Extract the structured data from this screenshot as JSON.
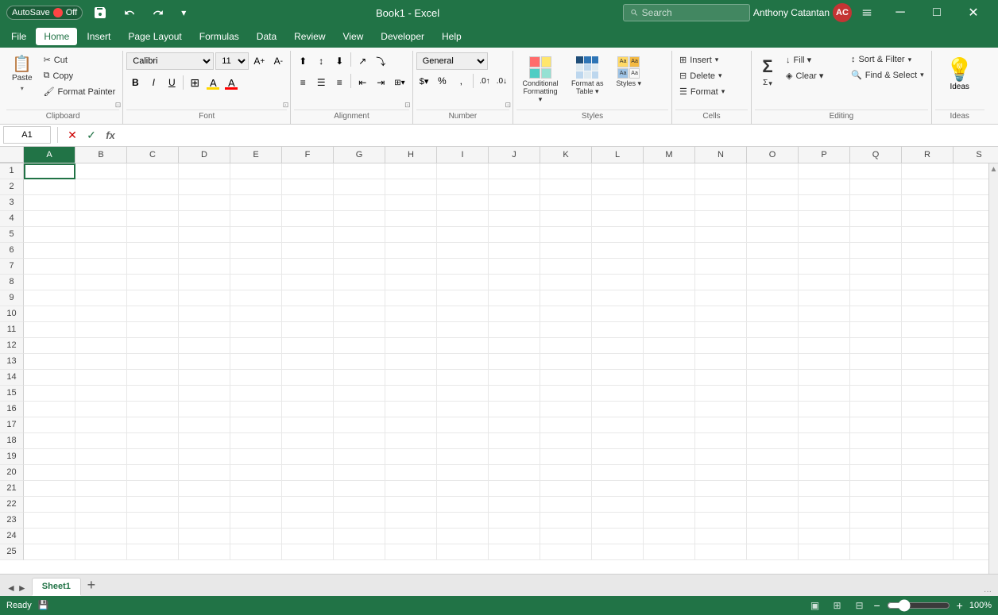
{
  "titleBar": {
    "autosave_label": "AutoSave",
    "autosave_status": "Off",
    "save_label": "💾",
    "undo_label": "↩",
    "redo_label": "↪",
    "title": "Book1 - Excel",
    "user_name": "Anthony Catantan",
    "user_initials": "AC",
    "minimize_label": "─",
    "maximize_label": "□",
    "close_label": "✕"
  },
  "menuBar": {
    "items": [
      "File",
      "Home",
      "Insert",
      "Page Layout",
      "Formulas",
      "Data",
      "Review",
      "View",
      "Developer",
      "Help"
    ]
  },
  "ribbon": {
    "groups": {
      "clipboard": {
        "label": "Clipboard",
        "paste_label": "Paste",
        "cut_label": "Cut",
        "copy_label": "Copy",
        "format_painter_label": "Format Painter"
      },
      "font": {
        "label": "Font",
        "font_name": "Calibri",
        "font_size": "11",
        "bold_label": "B",
        "italic_label": "I",
        "underline_label": "U",
        "increase_size_label": "A↑",
        "decrease_size_label": "A↓",
        "borders_label": "⊞",
        "fill_color_label": "A",
        "font_color_label": "A"
      },
      "alignment": {
        "label": "Alignment",
        "align_top_label": "≡↑",
        "align_middle_label": "≡",
        "align_bottom_label": "≡↓",
        "orient_label": "↗",
        "wrap_label": "⤵",
        "left_label": "≡",
        "center_label": "≡",
        "right_label": "≡",
        "decrease_indent_label": "⇤",
        "increase_indent_label": "⇥",
        "merge_label": "⊞",
        "expand_label": "⊡"
      },
      "number": {
        "label": "Number",
        "format_label": "General",
        "currency_label": "$",
        "percent_label": "%",
        "comma_label": ",",
        "increase_decimal_label": "↑.0",
        "decrease_decimal_label": "↓.0",
        "expand_label": "⊡"
      },
      "styles": {
        "label": "Styles",
        "conditional_formatting_label": "Conditional Formatting",
        "format_as_table_label": "Format as Table",
        "cell_styles_label": "Cell Styles",
        "styles_dropdown_label": "Styles ▾"
      },
      "cells": {
        "label": "Cells",
        "insert_label": "Insert",
        "delete_label": "Delete",
        "format_label": "Format"
      },
      "editing": {
        "label": "Editing",
        "sum_label": "Σ",
        "fill_label": "↓",
        "clear_label": "◈",
        "sort_filter_label": "Sort & Filter",
        "find_select_label": "Find & Select"
      },
      "ideas": {
        "label": "Ideas",
        "ideas_label": "Ideas"
      }
    },
    "search": {
      "placeholder": "Search"
    }
  },
  "formulaBar": {
    "cell_ref": "A1",
    "formula_content": ""
  },
  "grid": {
    "columns": [
      "A",
      "B",
      "C",
      "D",
      "E",
      "F",
      "G",
      "H",
      "I",
      "J",
      "K",
      "L",
      "M",
      "N",
      "O",
      "P",
      "Q",
      "R",
      "S"
    ],
    "rows": [
      1,
      2,
      3,
      4,
      5,
      6,
      7,
      8,
      9,
      10,
      11,
      12,
      13,
      14,
      15,
      16,
      17,
      18,
      19,
      20,
      21,
      22,
      23,
      24,
      25
    ],
    "selected_cell": "A1"
  },
  "sheetTabs": {
    "sheets": [
      "Sheet1"
    ],
    "active": "Sheet1",
    "add_label": "+"
  },
  "statusBar": {
    "status_label": "Ready",
    "save_icon_label": "💾",
    "zoom_level": "100%",
    "zoom_value": 100
  }
}
